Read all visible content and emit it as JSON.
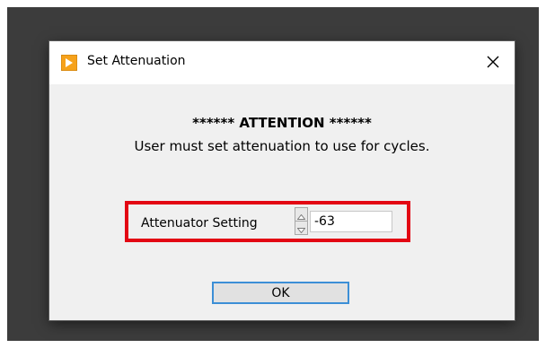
{
  "dialog": {
    "title": "Set Attenuation",
    "icons": {
      "app": "labview-run-arrow-icon",
      "close": "close-icon"
    }
  },
  "message": {
    "heading": "****** ATTENTION ******",
    "text": "User must set attenuation to use for cycles."
  },
  "attenuator": {
    "label": "Attenuator Setting",
    "value": "-63",
    "spinner_icons": {
      "up": "spin-up-icon",
      "down": "spin-down-icon"
    }
  },
  "buttons": {
    "ok": "OK"
  },
  "colors": {
    "highlight": "#e30613",
    "focus_border": "#3c8fd6",
    "app_icon_bg": "#f6a21b"
  }
}
